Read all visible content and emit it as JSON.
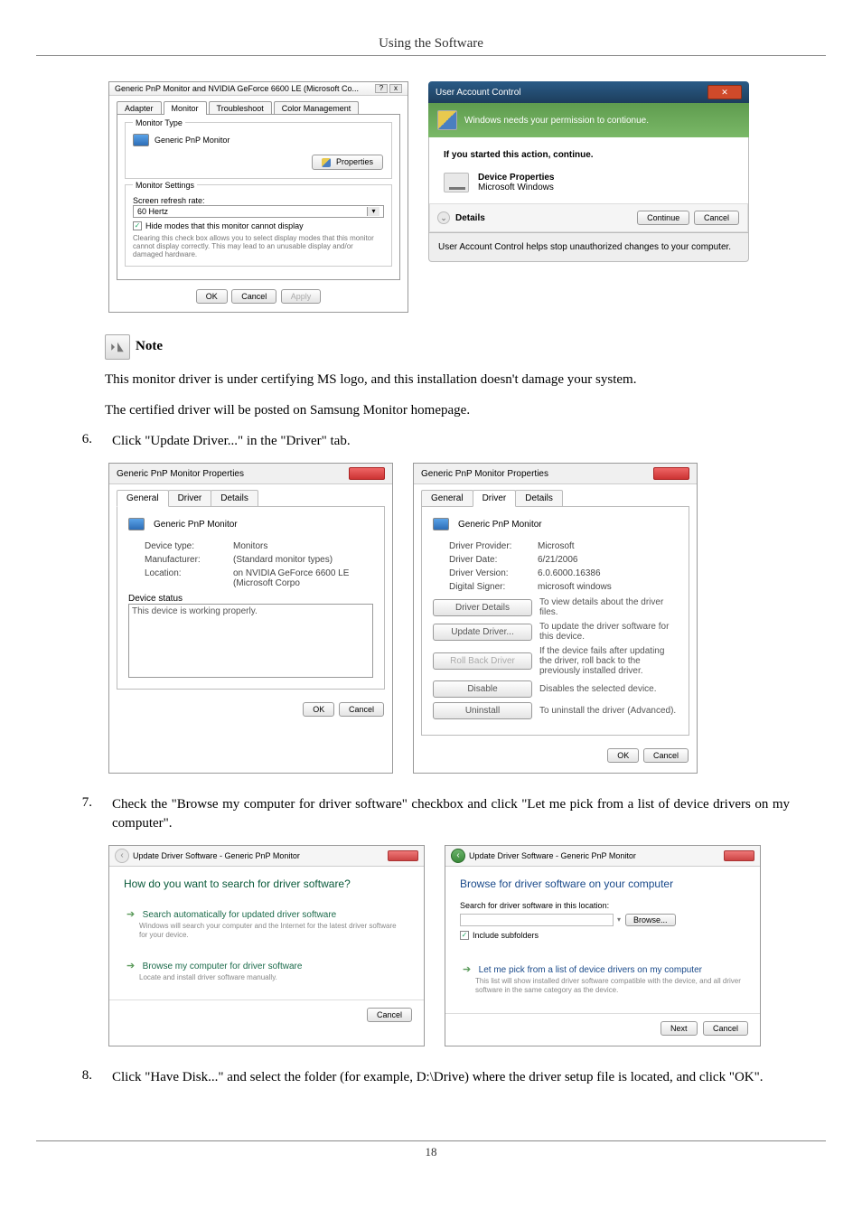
{
  "header": {
    "title": "Using the Software"
  },
  "dialog_props": {
    "window_title": "Generic PnP Monitor and NVIDIA GeForce 6600 LE (Microsoft Co...",
    "tabs": [
      "Adapter",
      "Monitor",
      "Troubleshoot",
      "Color Management"
    ],
    "monitor_type_group": "Monitor Type",
    "monitor_name": "Generic PnP Monitor",
    "properties_btn": "Properties",
    "monitor_settings_group": "Monitor Settings",
    "refresh_label": "Screen refresh rate:",
    "refresh_value": "60 Hertz",
    "hide_modes": "Hide modes that this monitor cannot display",
    "hide_desc": "Clearing this check box allows you to select display modes that this monitor cannot display correctly. This may lead to an unusable display and/or damaged hardware.",
    "ok": "OK",
    "cancel": "Cancel",
    "apply": "Apply"
  },
  "uac": {
    "title": "User Account Control",
    "bar": "Windows needs your permission to contionue.",
    "sub": "If you started this action, continue.",
    "device_line1": "Device Properties",
    "device_line2": "Microsoft Windows",
    "details": "Details",
    "continue": "Continue",
    "cancel": "Cancel",
    "footer": "User Account Control helps stop unauthorized changes to your computer."
  },
  "note": {
    "label": "Note"
  },
  "para1": "This monitor driver is under certifying MS logo, and this installation doesn't damage your system.",
  "para2": "The certified driver will be posted on Samsung Monitor homepage.",
  "step6": {
    "num": "6.",
    "text": "Click \"Update Driver...\" in the \"Driver\" tab."
  },
  "prop_general": {
    "title": "Generic PnP Monitor Properties",
    "tabs": [
      "General",
      "Driver",
      "Details"
    ],
    "name": "Generic PnP Monitor",
    "kv": {
      "device_type_lbl": "Device type:",
      "device_type": "Monitors",
      "manufacturer_lbl": "Manufacturer:",
      "manufacturer": "(Standard monitor types)",
      "location_lbl": "Location:",
      "location": "on NVIDIA GeForce 6600 LE (Microsoft Corpo"
    },
    "status_group": "Device status",
    "status_text": "This device is working properly.",
    "ok": "OK",
    "cancel": "Cancel"
  },
  "prop_driver": {
    "title": "Generic PnP Monitor Properties",
    "tabs": [
      "General",
      "Driver",
      "Details"
    ],
    "name": "Generic PnP Monitor",
    "kv": {
      "provider_lbl": "Driver Provider:",
      "provider": "Microsoft",
      "date_lbl": "Driver Date:",
      "date": "6/21/2006",
      "version_lbl": "Driver Version:",
      "version": "6.0.6000.16386",
      "signer_lbl": "Digital Signer:",
      "signer": "microsoft windows"
    },
    "btns": {
      "details": "Driver Details",
      "details_desc": "To view details about the driver files.",
      "update": "Update Driver...",
      "update_desc": "To update the driver software for this device.",
      "rollback": "Roll Back Driver",
      "rollback_desc": "If the device fails after updating the driver, roll back to the previously installed driver.",
      "disable": "Disable",
      "disable_desc": "Disables the selected device.",
      "uninstall": "Uninstall",
      "uninstall_desc": "To uninstall the driver (Advanced)."
    },
    "ok": "OK",
    "cancel": "Cancel"
  },
  "step7": {
    "num": "7.",
    "text": "Check the \"Browse my computer for driver software\" checkbox and click \"Let me pick from a list of device drivers on my computer\"."
  },
  "wizard1": {
    "breadcrumb": "Update Driver Software - Generic PnP Monitor",
    "heading": "How do you want to search for driver software?",
    "opt1_title": "Search automatically for updated driver software",
    "opt1_sub": "Windows will search your computer and the Internet for the latest driver software for your device.",
    "opt2_title": "Browse my computer for driver software",
    "opt2_sub": "Locate and install driver software manually.",
    "cancel": "Cancel"
  },
  "wizard2": {
    "breadcrumb": "Update Driver Software - Generic PnP Monitor",
    "heading": "Browse for driver software on your computer",
    "search_lbl": "Search for driver software in this location:",
    "browse": "Browse...",
    "include": "Include subfolders",
    "opt_title": "Let me pick from a list of device drivers on my computer",
    "opt_sub": "This list will show installed driver software compatible with the device, and all driver software in the same category as the device.",
    "next": "Next",
    "cancel": "Cancel"
  },
  "step8": {
    "num": "8.",
    "text": "Click \"Have Disk...\" and select the folder (for example, D:\\Drive) where the driver setup file is located, and click \"OK\"."
  },
  "footer": {
    "page": "18"
  }
}
